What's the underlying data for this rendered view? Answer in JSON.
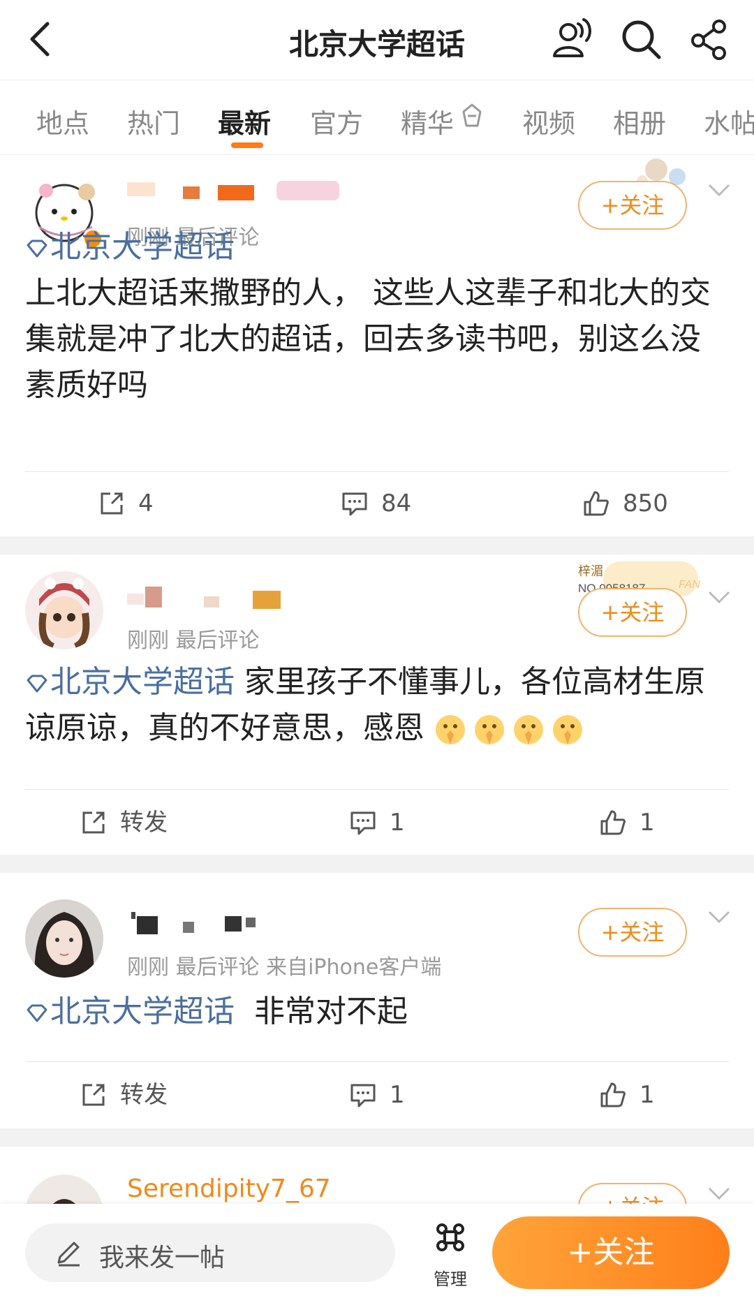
{
  "header": {
    "title": "北京大学超话"
  },
  "tabs": [
    {
      "label": "地点"
    },
    {
      "label": "热门"
    },
    {
      "label": "最新"
    },
    {
      "label": "官方"
    },
    {
      "label": "精华"
    },
    {
      "label": "视频"
    },
    {
      "label": "相册"
    },
    {
      "label": "水帖"
    }
  ],
  "active_tab": "最新",
  "follow_label": "+关注",
  "posts": [
    {
      "meta": "刚刚 最后评论",
      "topic": "北京大学超话",
      "text": "上北大超话来撒野的人， 这些人这辈子和北大的交集就是冲了北大的超话，回去多读书吧，别这么没素质好吗",
      "repost": "4",
      "comments": "84",
      "likes": "850"
    },
    {
      "meta": "刚刚 最后评论",
      "topic": "北京大学超话",
      "text": " 家里孩子不懂事儿，各位高材生原谅原谅，真的不好意思，感恩",
      "fan_badge_name": "梓湄",
      "fan_badge_no": "NO.0058187",
      "fan_badge_tag": "FANS",
      "repost": "转发",
      "comments": "1",
      "likes": "1"
    },
    {
      "meta": "刚刚 最后评论  来自iPhone客户端",
      "topic": "北京大学超话",
      "text": "  非常对不起",
      "repost": "转发",
      "comments": "1",
      "likes": "1"
    },
    {
      "username": "Serendipity7_67"
    }
  ],
  "bottom": {
    "compose_placeholder": "我来发一帖",
    "manage_label": "管理",
    "follow_button": "+关注"
  },
  "colors": {
    "accent": "#ff7a1a",
    "topic_link": "#4a6fa0",
    "follow_border": "#f2b26b"
  }
}
